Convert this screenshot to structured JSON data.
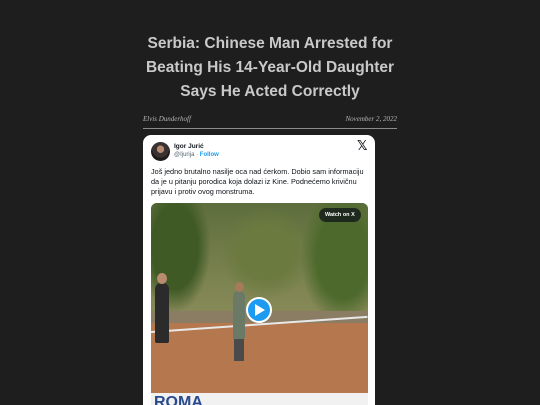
{
  "article": {
    "title": "Serbia: Chinese Man Arrested for Beating His 14-Year-Old Daughter Says He Acted Correctly",
    "author": "Elvis Dunderhoff",
    "date": "November 2, 2022"
  },
  "tweet": {
    "author_name": "Igor Jurić",
    "handle": "@Ijurija",
    "separator": "·",
    "follow_label": "Follow",
    "x_logo": "𝕏",
    "text": "Još jedno brutalno nasilje oca nad ćerkom. Dobio sam informaciju da je u pitanju porodica koja dolazi iz Kine. Podnećemo krivičnu prijavu i protiv ovog monstruma.",
    "video": {
      "watch_label": "Watch on X",
      "banner_text": "ROMA"
    }
  },
  "colors": {
    "page_bg": "#1e1e1e",
    "title_text": "#c9c9c9",
    "link_blue": "#1d9bf0",
    "play_button": "#1d9bf0"
  },
  "icons": {
    "play": "play-icon",
    "x": "x-logo-icon"
  }
}
